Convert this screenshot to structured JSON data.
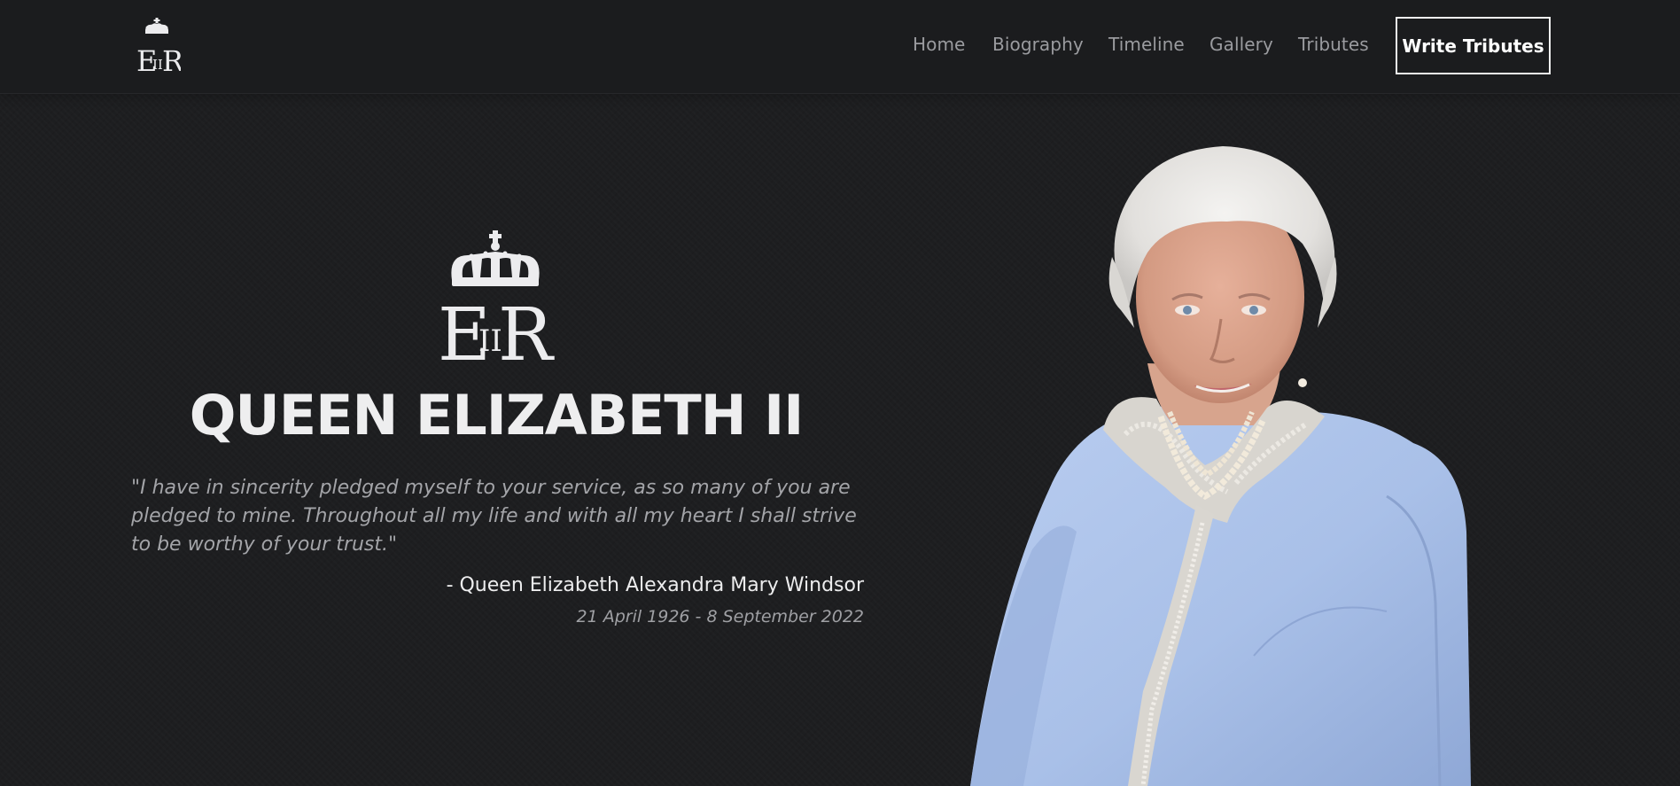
{
  "header": {
    "logo_icon": "eiir-royal-cypher-icon",
    "nav": [
      {
        "label": "Home"
      },
      {
        "label": "Biography"
      },
      {
        "label": "Timeline"
      },
      {
        "label": "Gallery"
      },
      {
        "label": "Tributes"
      }
    ],
    "cta_label": "Write Tributes"
  },
  "hero": {
    "monogram_icon": "crown-eiir-cypher-icon",
    "title": "QUEEN ELIZABETH II",
    "quote": "\"I have in sincerity pledged myself to your service, as so many of you are pledged to mine. Throughout all my life and with all my heart I shall strive to be worthy of your trust.\"",
    "attribution": "- Queen Elizabeth Alexandra Mary Windsor",
    "dates": "21 April 1926 - 8 September 2022",
    "portrait": "portrait-photo"
  },
  "colors": {
    "background": "#1c1d1f",
    "text_primary": "#eeeeef",
    "text_muted": "#a3a4a8",
    "nav_link": "#9a9b9f",
    "jacket": "#a9c0e8"
  }
}
